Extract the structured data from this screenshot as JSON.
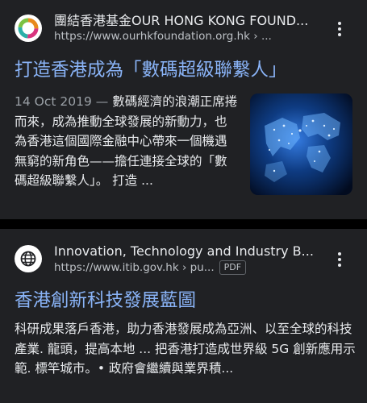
{
  "results": [
    {
      "site_name": "團結香港基金OUR HONG KONG FOUND...",
      "url": "https://www.ourhkfoundation.org.hk › ...",
      "title": "打造香港成為「數碼超級聯繫人」",
      "date": "14 Oct 2019 — ",
      "snippet": "數碼經濟的浪潮正席捲而來，成為推動全球發展的新動力，也為香港這個國際金融中心帶來一個機遇無窮的新角色——擔任連接全球的「數碼超級聯繫人」。 打造 ...",
      "favicon": "ring-logo-icon",
      "thumbnail": "glowing-world-map-image"
    },
    {
      "site_name": "Innovation, Technology and Industry B...",
      "url": "https://www.itib.gov.hk › pu...",
      "badge": "PDF",
      "title": "香港創新科技發展藍圖",
      "snippet": "科研成果落戶香港，助力香港發展成為亞洲、以至全球的科技產業. 龍頭，提高本地 ... 把香港打造成世界級 5G 創新應用示範. 標竿城市。• 政府會繼續與業界積...",
      "favicon": "globe-icon"
    }
  ],
  "colors": {
    "page_background": "#000000",
    "card_background": "#202124",
    "title_link": "#8ab4f8",
    "primary_text": "#e8eaed",
    "secondary_text": "#bdc1c6"
  }
}
